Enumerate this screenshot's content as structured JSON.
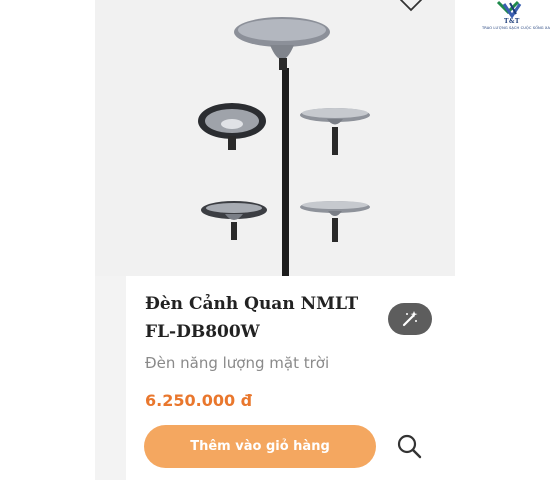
{
  "brand": {
    "logo_text": "T&T",
    "tagline": "TRAO LƯỢNG SẠCH CUỘC SỐNG XANH"
  },
  "product": {
    "title": "Đèn Cảnh Quan NMLT FL-DB800W",
    "category": "Đèn năng lượng mặt trời",
    "price": "6.250.000 đ",
    "image_subject": "solar landscape lamp"
  },
  "actions": {
    "add_to_cart_label": "Thêm vào giỏ hàng",
    "wishlist_icon": "heart-icon",
    "search_icon": "search-icon",
    "magic_icon": "magic-wand-icon"
  },
  "colors": {
    "accent": "#f4a760",
    "price": "#e9772d",
    "title": "#222222",
    "muted": "#8a8a8a",
    "magic_button_bg": "#5d5d5d"
  }
}
